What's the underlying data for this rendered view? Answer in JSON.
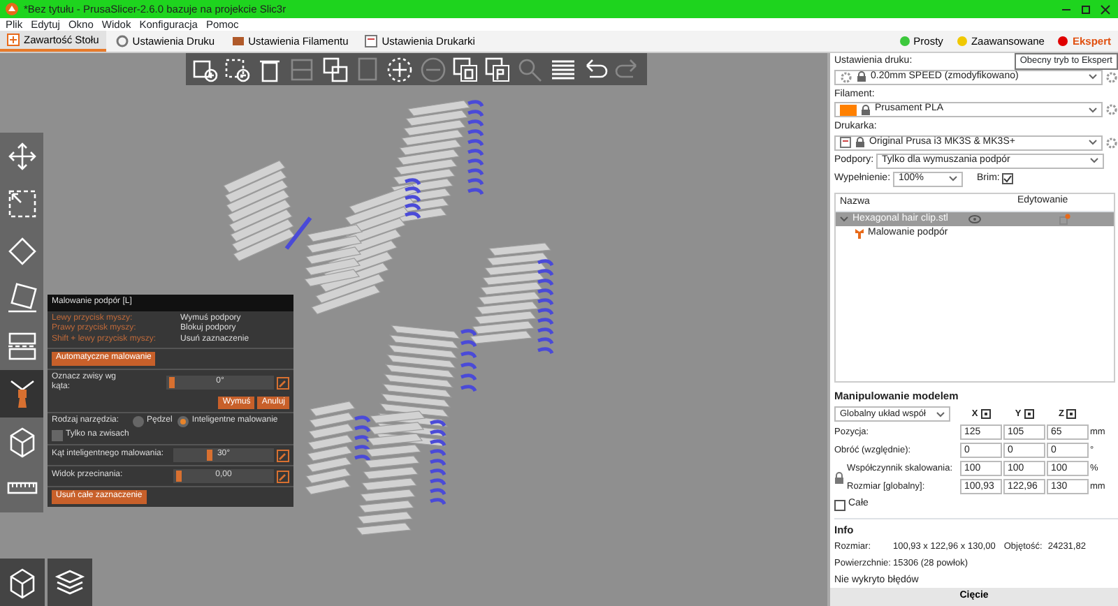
{
  "window": {
    "title": "*Bez tytułu - PrusaSlicer-2.6.0 bazuje na projekcie Slic3r"
  },
  "menu": [
    "Plik",
    "Edytuj",
    "Okno",
    "Widok",
    "Konfiguracja",
    "Pomoc"
  ],
  "tabs": [
    {
      "label": "Zawartość Stołu",
      "selected": true
    },
    {
      "label": "Ustawienia Druku",
      "selected": false
    },
    {
      "label": "Ustawienia Filamentu",
      "selected": false
    },
    {
      "label": "Ustawienia Drukarki",
      "selected": false
    }
  ],
  "modes": [
    {
      "label": "Prosty",
      "color": "#3cc83c",
      "selected": false
    },
    {
      "label": "Zaawansowane",
      "color": "#f0c800",
      "selected": false
    },
    {
      "label": "Ekspert",
      "color": "#e00000",
      "selected": true
    }
  ],
  "tooltip": "Obecny tryb to Ekspert",
  "toolbar": [
    {
      "disabled": false
    },
    {
      "disabled": false
    },
    {
      "disabled": false
    },
    {
      "disabled": true
    },
    {
      "disabled": false
    },
    {
      "disabled": true
    },
    {
      "disabled": false
    },
    {
      "disabled": true
    },
    {
      "disabled": false
    },
    {
      "disabled": false
    },
    {
      "disabled": true
    },
    {
      "disabled": false
    },
    {
      "disabled": false
    },
    {
      "disabled": true
    }
  ],
  "gizmo_bar": [
    {
      "selected": false
    },
    {
      "selected": false
    },
    {
      "selected": false
    },
    {
      "selected": false
    },
    {
      "selected": false
    },
    {
      "selected": true
    },
    {
      "selected": false
    },
    {
      "selected": false
    }
  ],
  "gizmo": {
    "title": "Malowanie podpór [L]",
    "mouse": [
      {
        "key": "Lewy przycisk myszy:",
        "action": "Wymuś podpory"
      },
      {
        "key": "Prawy przycisk myszy:",
        "action": "Blokuj podpory"
      },
      {
        "key": "Shift + lewy przycisk myszy:",
        "action": "Usuń zaznaczenie"
      }
    ],
    "auto_button": "Automatyczne malowanie",
    "overhang": {
      "label": "Oznacz zwisy wg kąta:",
      "level": 0.03,
      "reading": "0°",
      "buttons": [
        "Wymuś",
        "Anuluj"
      ]
    },
    "tool": {
      "label": "Rodzaj narzędzia:",
      "options": [
        {
          "label": "Pędzel",
          "selected": false
        },
        {
          "label": "Inteligentne malowanie",
          "selected": true
        }
      ]
    },
    "overhangs_only": {
      "label": "Tylko na zwisach",
      "checked": false
    },
    "sliders": [
      {
        "label": "Kąt inteligentnego malowania:",
        "level": 0.33,
        "reading": "30°"
      },
      {
        "label": "Widok przecinania:",
        "level": 0.03,
        "reading": "0,00"
      }
    ],
    "clear_button": "Usuń całe zaznaczenie"
  },
  "sidebar": {
    "presets": [
      {
        "kind": "print",
        "label": "Ustawienia druku:",
        "value": "0.20mm SPEED (zmodyfikowano)"
      },
      {
        "kind": "filament",
        "label": "Filament:",
        "value": "Prusament PLA",
        "color": "#ff8000"
      },
      {
        "kind": "printer",
        "label": "Drukarka:",
        "value": "Original Prusa i3 MK3S & MK3S+"
      }
    ],
    "supports": {
      "label": "Podpory:",
      "value": "Tylko dla wymuszania podpór"
    },
    "infill": {
      "label": "Wypełnienie:",
      "value": "100%"
    },
    "brim": {
      "label": "Brim:",
      "checked": true
    },
    "objects": {
      "columns": [
        "Nazwa",
        "Edytowanie"
      ],
      "rows": [
        {
          "name": "Hexagonal hair clip.stl",
          "selected": true,
          "expanded": true,
          "children": [
            {
              "name": "Malowanie podpór",
              "selected": false
            }
          ]
        }
      ]
    },
    "manipulation": {
      "title": "Manipulowanie modelem",
      "coord": "Globalny układ współ",
      "axes": [
        "X",
        "Y",
        "Z"
      ],
      "rows": [
        {
          "label": "Pozycja:",
          "values": [
            "125",
            "105",
            "65"
          ],
          "unit": "mm"
        },
        {
          "label": "Obróć (względnie):",
          "values": [
            "0",
            "0",
            "0"
          ],
          "unit": "°"
        },
        {
          "label": "Współczynnik skalowania:",
          "values": [
            "100",
            "100",
            "100"
          ],
          "unit": "%"
        },
        {
          "label": "Rozmiar [globalny]:",
          "values": [
            "100,93",
            "122,96",
            "130"
          ],
          "unit": "mm"
        }
      ],
      "scale_locked": true,
      "whole": {
        "label": "Całe",
        "checked": false
      }
    },
    "info": {
      "title": "Info",
      "size_label": "Rozmiar:",
      "size": "100,93 x 122,96 x 130,00",
      "volume_label": "Objętość:",
      "volume": "24231,82",
      "facets_label": "Powierzchnie:",
      "facets": "15306 (28 powłok)",
      "status": "Nie wykryto błędów"
    },
    "slice_button": "Cięcie"
  }
}
